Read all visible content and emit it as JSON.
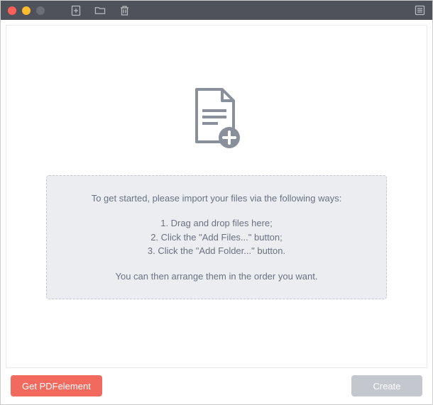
{
  "instructions": {
    "intro": "To get started, please import your files via the following ways:",
    "step1": "1. Drag and drop files here;",
    "step2": "2. Click the \"Add Files...\" button;",
    "step3": "3. Click the \"Add Folder...\" button.",
    "outro": "You can then arrange them in the order you want."
  },
  "footer": {
    "get_pdfelement": "Get PDFelement",
    "create": "Create"
  }
}
